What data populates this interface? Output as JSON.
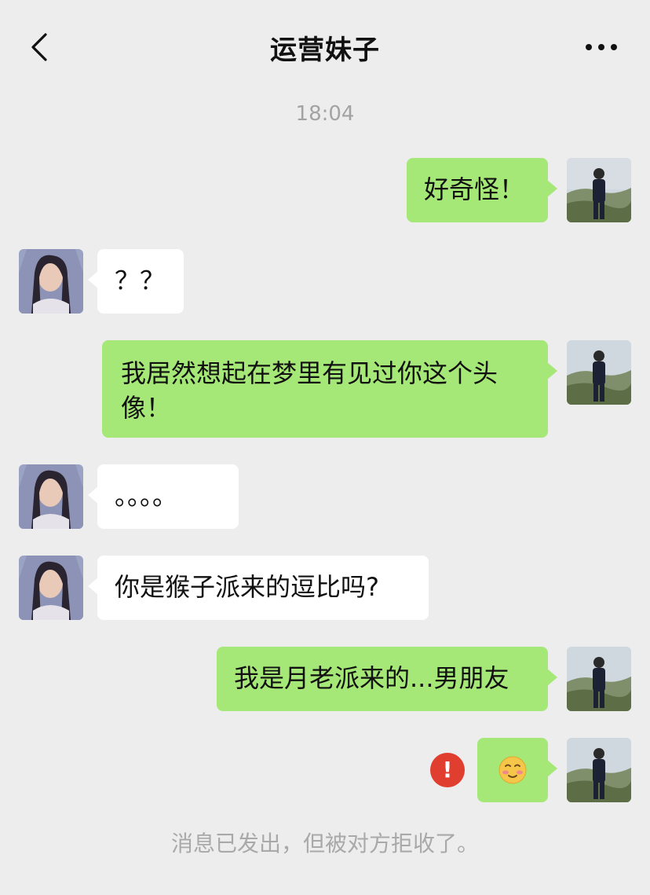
{
  "header": {
    "title": "运营妹子",
    "back_icon": "chevron-left-icon",
    "more_icon": "more-dots-icon"
  },
  "timestamp": "18:04",
  "messages": [
    {
      "from": "me",
      "text": "好奇怪！"
    },
    {
      "from": "them",
      "text": "？？"
    },
    {
      "from": "me",
      "text": "我居然想起在梦里有见过你这个头像！"
    },
    {
      "from": "them",
      "text": "。。。。"
    },
    {
      "from": "them",
      "text": "你是猴子派来的逗比吗?"
    },
    {
      "from": "me",
      "text": "我是月老派来的...男朋友"
    },
    {
      "from": "me",
      "text": "",
      "emoji": "blushing-face-emoji",
      "failed": true
    }
  ],
  "error_mark": "!",
  "system_note": "消息已发出，但被对方拒收了。",
  "colors": {
    "background": "#ededed",
    "my_bubble": "#a5e877",
    "their_bubble": "#ffffff",
    "error": "#e03f30",
    "muted_text": "#a9a9a9"
  }
}
